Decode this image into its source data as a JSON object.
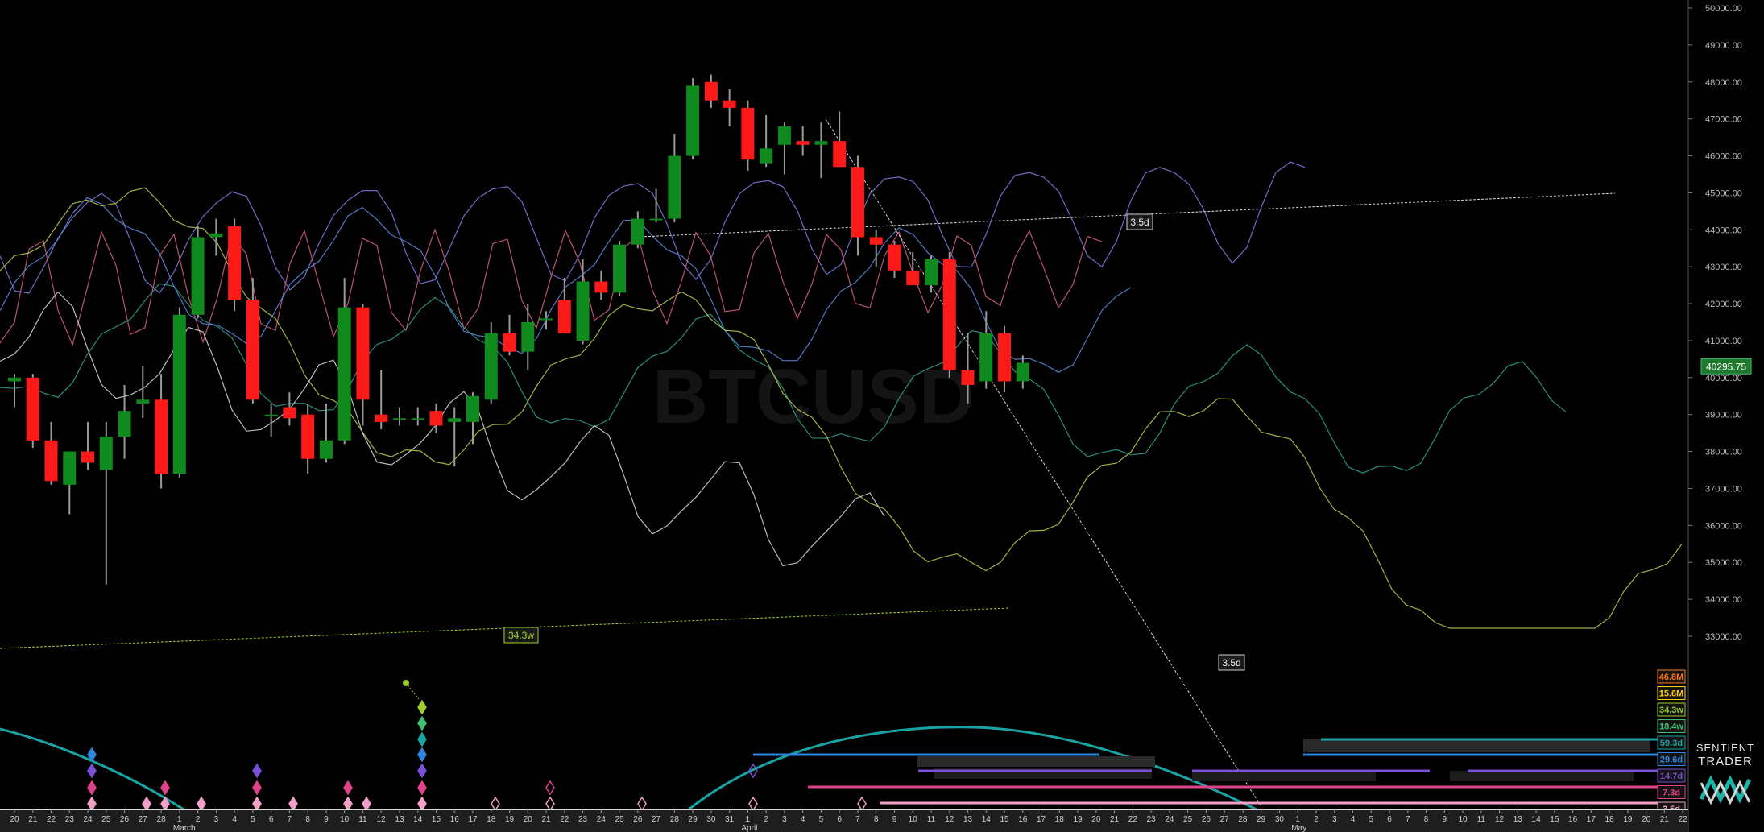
{
  "chart_data": {
    "type": "candlestick",
    "symbol_watermark": "BTCUSD",
    "y_axis": {
      "min": 33000,
      "max": 50000,
      "ticks": [
        "50000.00",
        "49000.00",
        "48000.00",
        "47000.00",
        "46000.00",
        "45000.00",
        "44000.00",
        "43000.00",
        "42000.00",
        "41000.00",
        "40000.00",
        "39000.00",
        "38000.00",
        "37000.00",
        "36000.00",
        "35000.00",
        "34000.00",
        "33000.00"
      ],
      "tick_values": [
        50000,
        49000,
        48000,
        47000,
        46000,
        45000,
        44000,
        43000,
        42000,
        41000,
        40000,
        39000,
        38000,
        37000,
        36000,
        35000,
        34000,
        33000
      ]
    },
    "current_price": {
      "label": "40295.75",
      "value": 40295.75,
      "color": "#1f7a2e"
    },
    "x_axis": {
      "day_labels": [
        "20",
        "21",
        "22",
        "23",
        "24",
        "25",
        "26",
        "27",
        "28",
        "1",
        "2",
        "3",
        "4",
        "5",
        "6",
        "7",
        "8",
        "9",
        "10",
        "11",
        "12",
        "13",
        "14",
        "15",
        "16",
        "17",
        "18",
        "19",
        "20",
        "21",
        "22",
        "23",
        "24",
        "25",
        "26",
        "27",
        "28",
        "29",
        "30",
        "31",
        "1",
        "2",
        "3",
        "4",
        "5",
        "6",
        "7",
        "8",
        "9",
        "10",
        "11",
        "12",
        "13",
        "14",
        "15",
        "16",
        "17",
        "18",
        "19",
        "20",
        "21",
        "22",
        "23",
        "24",
        "25",
        "26",
        "27",
        "28",
        "29",
        "30",
        "1",
        "2",
        "3",
        "4",
        "5",
        "6",
        "7",
        "8",
        "9",
        "10",
        "11",
        "12",
        "13",
        "14",
        "15",
        "16",
        "17",
        "18",
        "19",
        "20",
        "21",
        "22"
      ],
      "month_labels": [
        {
          "text": "March",
          "at_index": 9
        },
        {
          "text": "April",
          "at_index": 40
        },
        {
          "text": "May",
          "at_index": 70
        }
      ]
    },
    "candles": [
      {
        "o": 39900,
        "h": 40100,
        "l": 39200,
        "c": 40000
      },
      {
        "o": 40000,
        "h": 40100,
        "l": 38100,
        "c": 38300
      },
      {
        "o": 38300,
        "h": 38800,
        "l": 37100,
        "c": 37200
      },
      {
        "o": 37100,
        "h": 38000,
        "l": 36300,
        "c": 38000
      },
      {
        "o": 38000,
        "h": 38800,
        "l": 37500,
        "c": 37700
      },
      {
        "o": 37500,
        "h": 38800,
        "l": 34400,
        "c": 38400
      },
      {
        "o": 38400,
        "h": 39800,
        "l": 37800,
        "c": 39100
      },
      {
        "o": 39300,
        "h": 40300,
        "l": 38900,
        "c": 39400
      },
      {
        "o": 39400,
        "h": 40100,
        "l": 37000,
        "c": 37400
      },
      {
        "o": 37400,
        "h": 41900,
        "l": 37300,
        "c": 41700
      },
      {
        "o": 41700,
        "h": 44100,
        "l": 41600,
        "c": 43800
      },
      {
        "o": 43800,
        "h": 44300,
        "l": 43300,
        "c": 43900
      },
      {
        "o": 44100,
        "h": 44300,
        "l": 41800,
        "c": 42100
      },
      {
        "o": 42100,
        "h": 42700,
        "l": 39300,
        "c": 39400
      },
      {
        "o": 39000,
        "h": 39300,
        "l": 38400,
        "c": 39000
      },
      {
        "o": 39200,
        "h": 39600,
        "l": 38700,
        "c": 38900
      },
      {
        "o": 39000,
        "h": 39300,
        "l": 37400,
        "c": 37800
      },
      {
        "o": 37800,
        "h": 39300,
        "l": 37700,
        "c": 38300
      },
      {
        "o": 38300,
        "h": 42700,
        "l": 38200,
        "c": 41900
      },
      {
        "o": 41900,
        "h": 42000,
        "l": 38700,
        "c": 39400
      },
      {
        "o": 39000,
        "h": 40200,
        "l": 38600,
        "c": 38800
      },
      {
        "o": 38900,
        "h": 39200,
        "l": 38700,
        "c": 38900
      },
      {
        "o": 38900,
        "h": 39200,
        "l": 38700,
        "c": 38900
      },
      {
        "o": 39100,
        "h": 39300,
        "l": 38500,
        "c": 38700
      },
      {
        "o": 38800,
        "h": 39200,
        "l": 37600,
        "c": 38900
      },
      {
        "o": 38800,
        "h": 39600,
        "l": 38200,
        "c": 39500
      },
      {
        "o": 39400,
        "h": 41500,
        "l": 39300,
        "c": 41200
      },
      {
        "o": 41200,
        "h": 41700,
        "l": 40600,
        "c": 40700
      },
      {
        "o": 40700,
        "h": 42000,
        "l": 40200,
        "c": 41500
      },
      {
        "o": 41600,
        "h": 41800,
        "l": 41300,
        "c": 41600
      },
      {
        "o": 42100,
        "h": 42700,
        "l": 41500,
        "c": 41200
      },
      {
        "o": 41000,
        "h": 43200,
        "l": 40900,
        "c": 42600
      },
      {
        "o": 42600,
        "h": 42900,
        "l": 42100,
        "c": 42300
      },
      {
        "o": 42300,
        "h": 43700,
        "l": 42200,
        "c": 43600
      },
      {
        "o": 43600,
        "h": 44500,
        "l": 43500,
        "c": 44300
      },
      {
        "o": 44300,
        "h": 45100,
        "l": 44200,
        "c": 44300
      },
      {
        "o": 44300,
        "h": 46600,
        "l": 44200,
        "c": 46000
      },
      {
        "o": 46000,
        "h": 48100,
        "l": 45900,
        "c": 47900
      },
      {
        "o": 48000,
        "h": 48200,
        "l": 47300,
        "c": 47500
      },
      {
        "o": 47500,
        "h": 47800,
        "l": 46800,
        "c": 47300
      },
      {
        "o": 47300,
        "h": 47500,
        "l": 45600,
        "c": 45900
      },
      {
        "o": 45800,
        "h": 47100,
        "l": 45700,
        "c": 46200
      },
      {
        "o": 46300,
        "h": 46900,
        "l": 45500,
        "c": 46800
      },
      {
        "o": 46400,
        "h": 46800,
        "l": 46000,
        "c": 46300
      },
      {
        "o": 46300,
        "h": 46900,
        "l": 45400,
        "c": 46400
      },
      {
        "o": 46400,
        "h": 47200,
        "l": 45700,
        "c": 45700
      },
      {
        "o": 45700,
        "h": 46000,
        "l": 43300,
        "c": 43800
      },
      {
        "o": 43800,
        "h": 44000,
        "l": 43000,
        "c": 43600
      },
      {
        "o": 43600,
        "h": 43700,
        "l": 42700,
        "c": 42900
      },
      {
        "o": 42900,
        "h": 43400,
        "l": 42500,
        "c": 42500
      },
      {
        "o": 42500,
        "h": 43300,
        "l": 42300,
        "c": 43200
      },
      {
        "o": 43200,
        "h": 43400,
        "l": 40000,
        "c": 40200
      },
      {
        "o": 40200,
        "h": 41200,
        "l": 39300,
        "c": 39800
      },
      {
        "o": 39900,
        "h": 41800,
        "l": 39700,
        "c": 41200
      },
      {
        "o": 41200,
        "h": 41400,
        "l": 39600,
        "c": 39900
      },
      {
        "o": 39900,
        "h": 40600,
        "l": 39700,
        "c": 40400
      }
    ],
    "cycle_labels": [
      {
        "text": "46.8M",
        "color": "#ff7a1a"
      },
      {
        "text": "15.6M",
        "color": "#ffd21a"
      },
      {
        "text": "34.3w",
        "color": "#9ccf2f"
      },
      {
        "text": "18.4w",
        "color": "#3fbf6f"
      },
      {
        "text": "59.3d",
        "color": "#19a3a3"
      },
      {
        "text": "29.6d",
        "color": "#2e86de"
      },
      {
        "text": "14.7d",
        "color": "#7b4fd6"
      },
      {
        "text": "7.3d",
        "color": "#e0428a"
      },
      {
        "text": "3.5d",
        "color": "#f2a0c8"
      }
    ],
    "annotations": [
      {
        "text": "3.5d",
        "kind": "channel-label-upper",
        "color": "#f0f0f0"
      },
      {
        "text": "3.5d",
        "kind": "channel-label-lower",
        "color": "#f0f0f0"
      },
      {
        "text": "34.3w",
        "kind": "channel-label",
        "color": "#9ccf2f"
      }
    ],
    "brand": {
      "line1": "SENTIENT",
      "line2": "TRADER"
    }
  }
}
